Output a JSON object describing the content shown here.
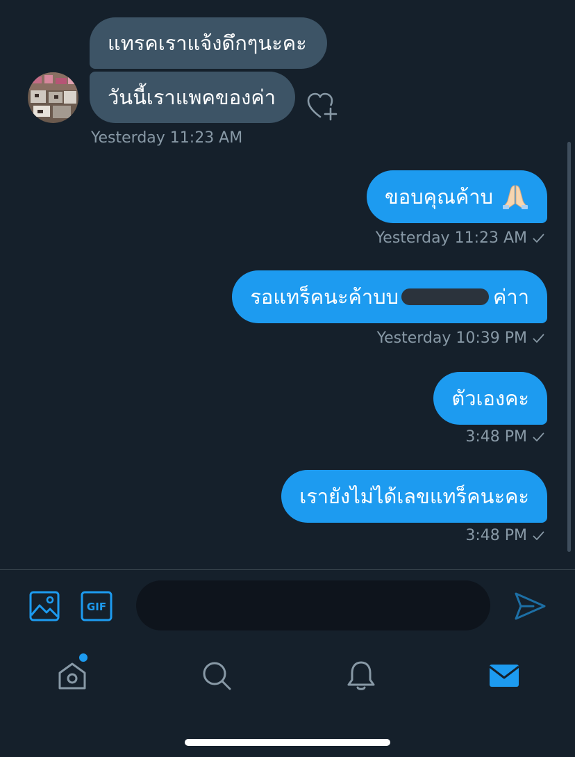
{
  "conversation": {
    "incoming": [
      {
        "text": "แทรคเราแจ้งดึกๆนะคะ"
      },
      {
        "text": "วันนี้เราแพคของค่า"
      }
    ],
    "incoming_timestamp": "Yesterday 11:23 AM",
    "outgoing": [
      {
        "text": "ขอบคุณค้าบ",
        "emoji": "folded-hands",
        "timestamp": "Yesterday 11:23 AM"
      },
      {
        "text_before": "รอแทร็คนะค้าบบ ",
        "text_after": "ค่าา",
        "timestamp": "Yesterday 10:39 PM"
      },
      {
        "text": "ตัวเองคะ",
        "timestamp": "3:48 PM"
      },
      {
        "text": "เรายังไม่ได้เลขแทร็คนะคะ",
        "timestamp": "3:48 PM"
      }
    ]
  },
  "compose": {
    "placeholder": "",
    "value": "",
    "image_icon": "image-icon",
    "gif_label": "GIF",
    "send_icon": "send-icon"
  },
  "tabbar": {
    "items": [
      "home",
      "search",
      "notifications",
      "messages"
    ],
    "active": "messages",
    "home_has_badge": true
  },
  "colors": {
    "background": "#15202b",
    "incoming_bubble": "#3d5466",
    "outgoing_bubble": "#1d9bf0",
    "accent": "#1d9bf0",
    "muted_text": "#8899a6"
  }
}
